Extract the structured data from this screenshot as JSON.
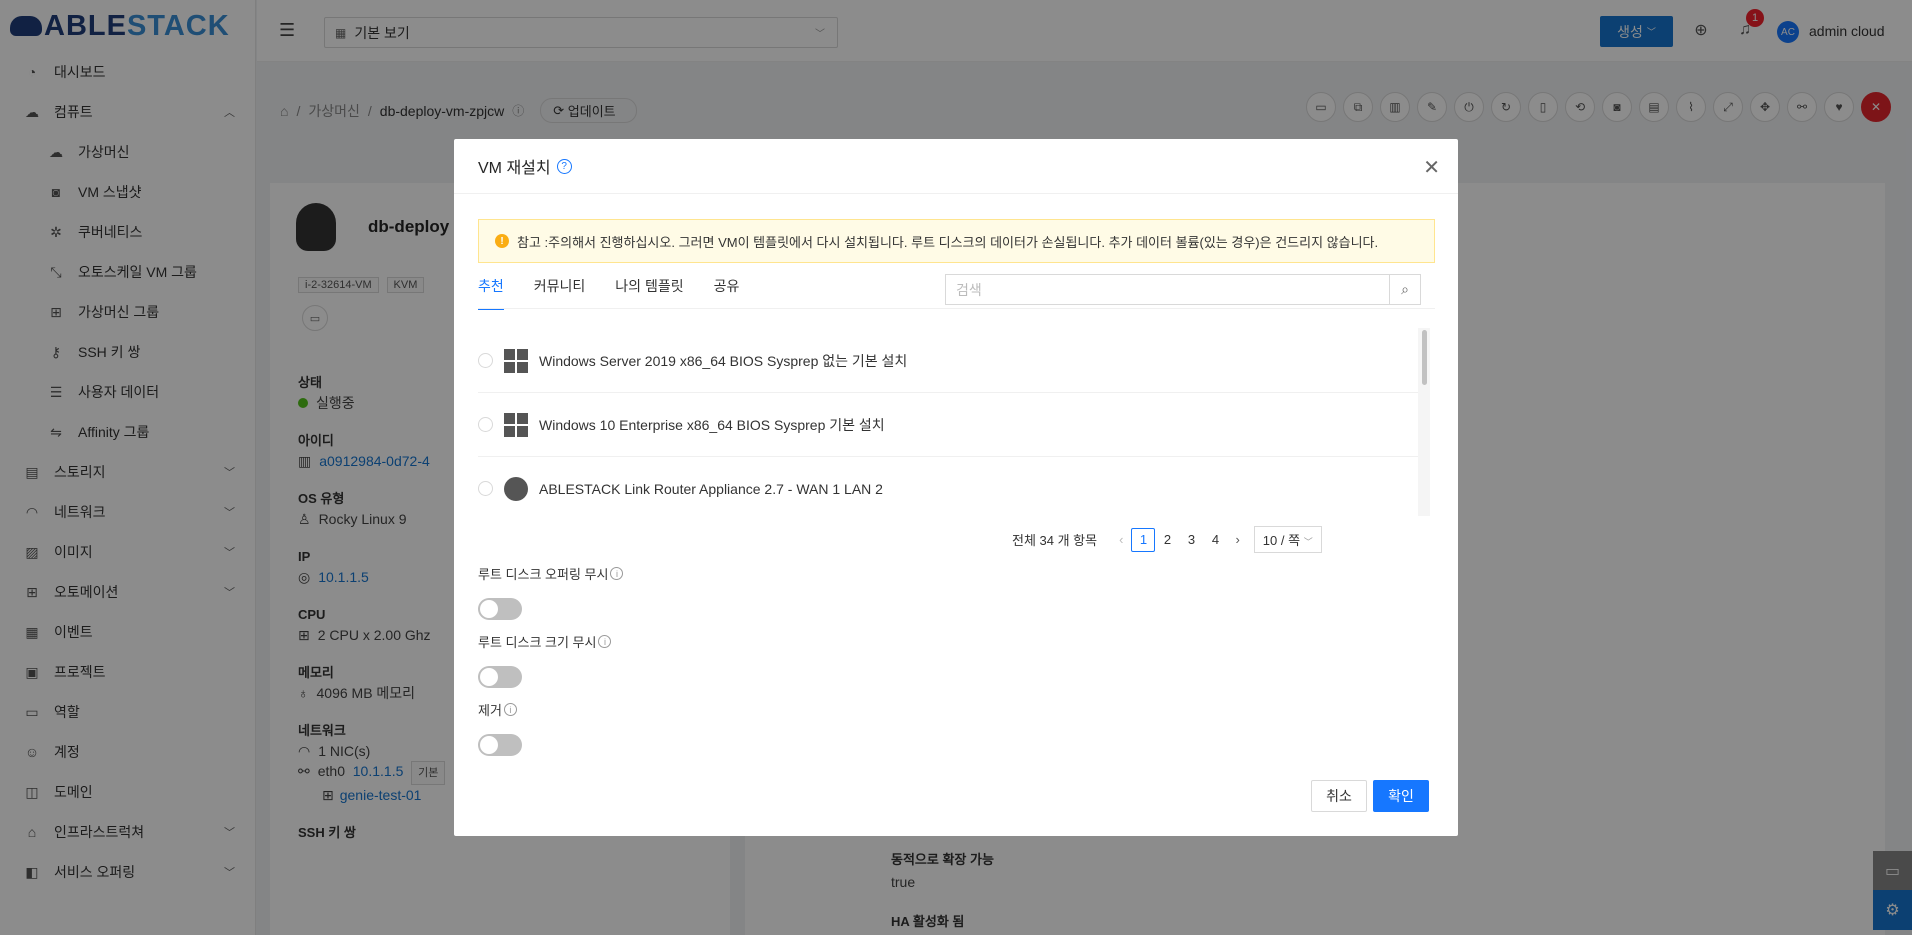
{
  "app": {
    "brand_a": "ABLE",
    "brand_b": "STACK"
  },
  "sidebar": {
    "items": [
      {
        "label": "대시보드",
        "icon": "dashboard-icon",
        "glyph": "◔",
        "sub": false
      },
      {
        "label": "컴퓨트",
        "icon": "cloud-icon",
        "glyph": "☁",
        "sub": false,
        "chev": "︿"
      },
      {
        "label": "가상머신",
        "icon": "cloud-server-icon",
        "glyph": "☁",
        "sub": true
      },
      {
        "label": "VM 스냅샷",
        "icon": "camera-icon",
        "glyph": "◙",
        "sub": true
      },
      {
        "label": "쿠버네티스",
        "icon": "helm-icon",
        "glyph": "✲",
        "sub": true
      },
      {
        "label": "오토스케일 VM 그룹",
        "icon": "autoscale-icon",
        "glyph": "⤡",
        "sub": true
      },
      {
        "label": "가상머신 그룹",
        "icon": "cluster-icon",
        "glyph": "⊞",
        "sub": true
      },
      {
        "label": "SSH 키 쌍",
        "icon": "key-icon",
        "glyph": "⚷",
        "sub": true
      },
      {
        "label": "사용자 데이터",
        "icon": "document-icon",
        "glyph": "☰",
        "sub": true
      },
      {
        "label": "Affinity 그룹",
        "icon": "swap-icon",
        "glyph": "⇋",
        "sub": true
      },
      {
        "label": "스토리지",
        "icon": "database-icon",
        "glyph": "▤",
        "sub": false,
        "chev": "﹀"
      },
      {
        "label": "네트워크",
        "icon": "wifi-icon",
        "glyph": "◠",
        "sub": false,
        "chev": "﹀"
      },
      {
        "label": "이미지",
        "icon": "picture-icon",
        "glyph": "▨",
        "sub": false,
        "chev": "﹀"
      },
      {
        "label": "오토메이션",
        "icon": "apps-icon",
        "glyph": "⊞",
        "sub": false,
        "chev": "﹀"
      },
      {
        "label": "이벤트",
        "icon": "calendar-icon",
        "glyph": "▦",
        "sub": false
      },
      {
        "label": "프로젝트",
        "icon": "project-icon",
        "glyph": "▣",
        "sub": false
      },
      {
        "label": "역할",
        "icon": "idcard-icon",
        "glyph": "▭",
        "sub": false
      },
      {
        "label": "계정",
        "icon": "user-icon",
        "glyph": "☺",
        "sub": false
      },
      {
        "label": "도메인",
        "icon": "block-icon",
        "glyph": "◫",
        "sub": false
      },
      {
        "label": "인프라스트럭쳐",
        "icon": "bank-icon",
        "glyph": "⌂",
        "sub": false,
        "chev": "﹀"
      },
      {
        "label": "서비스 오퍼링",
        "icon": "shopping-icon",
        "glyph": "◧",
        "sub": false,
        "chev": "﹀"
      }
    ]
  },
  "header": {
    "view_select": "기본 보기",
    "create_label": "생성",
    "notif_count": "1",
    "avatar_initials": "AC",
    "username": "admin cloud"
  },
  "breadcrumb": {
    "part1": "가상머신",
    "part2": "db-deploy-vm-zpjcw",
    "update_label": "업데이트"
  },
  "details": {
    "vm_name": "db-deploy",
    "tags": [
      "i-2-32614-VM",
      "KVM"
    ],
    "state_label": "상태",
    "state_value": "실행중",
    "id_label": "아이디",
    "id_value": "a0912984-0d72-4",
    "os_label": "OS 유형",
    "os_value": "Rocky Linux 9",
    "ip_label": "IP",
    "ip_value": "10.1.1.5",
    "cpu_label": "CPU",
    "cpu_value": "2 CPU x 2.00 Ghz",
    "mem_label": "메모리",
    "mem_value": "4096 MB 메모리",
    "net_label": "네트워크",
    "net_nics": "1 NIC(s)",
    "net_eth": "eth0",
    "net_ip": "10.1.1.5",
    "net_tag": "기본",
    "net_name": "genie-test-01",
    "ssh_label": "SSH 키 쌍",
    "right_label1": "동적으로 확장 가능",
    "right_value1": "true",
    "right_label2": "HA 활성화 됨"
  },
  "modal": {
    "title": "VM 재설치",
    "alert": "참고 :주의해서 진행하십시오. 그러면 VM이 템플릿에서 다시 설치됩니다. 루트 디스크의 데이터가 손실됩니다. 추가 데이터 볼륨(있는 경우)은 건드리지 않습니다.",
    "tabs": [
      "추천",
      "커뮤니티",
      "나의 템플릿",
      "공유"
    ],
    "search_placeholder": "검색",
    "templates": [
      {
        "label": "Windows Server 2019 x86_64 BIOS Sysprep 없는 기본 설치",
        "icon": "windows-icon"
      },
      {
        "label": "Windows 10 Enterprise x86_64 BIOS Sysprep 기본 설치",
        "icon": "windows-icon"
      },
      {
        "label": "ABLESTACK Link Router Appliance 2.7 - WAN 1 LAN 2",
        "icon": "router-icon"
      }
    ],
    "pager": {
      "total": "전체 34 개 항목",
      "pages": [
        "1",
        "2",
        "3",
        "4"
      ],
      "page_size": "10 / 쪽"
    },
    "opt1": "루트 디스크 오퍼링 무시",
    "opt2": "루트 디스크 크기 무시",
    "opt3": "제거",
    "cancel": "취소",
    "ok": "확인"
  }
}
